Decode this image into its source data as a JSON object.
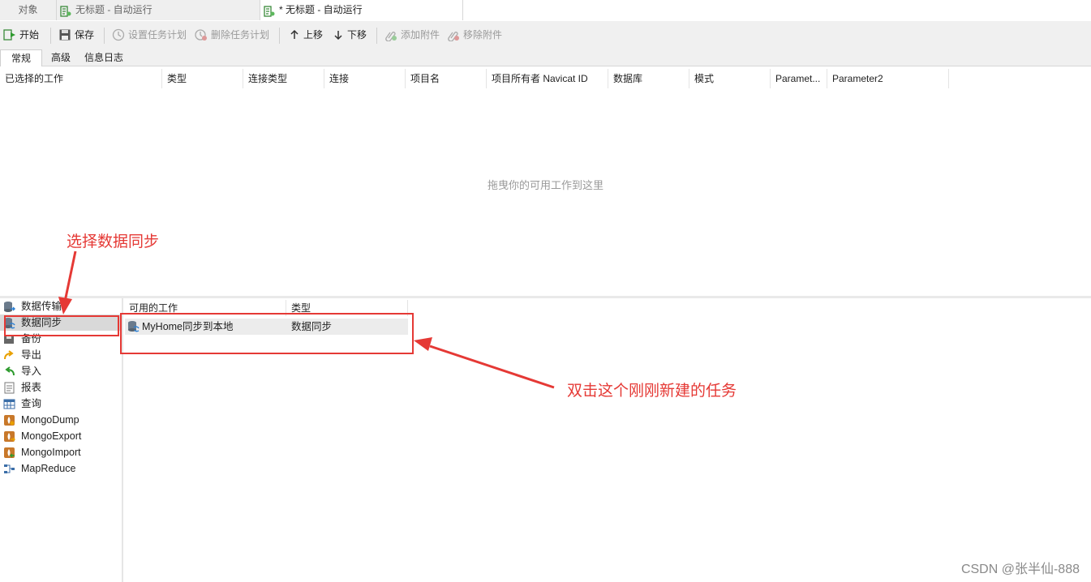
{
  "window_tabs": [
    {
      "label": "对象"
    },
    {
      "label": "无标题 - 自动运行"
    },
    {
      "label": "* 无标题 - 自动运行"
    }
  ],
  "toolbar": {
    "start": "开始",
    "save": "保存",
    "set_schedule": "设置任务计划",
    "delete_schedule": "删除任务计划",
    "move_up": "上移",
    "move_down": "下移",
    "add_attachment": "添加附件",
    "remove_attachment": "移除附件"
  },
  "sub_tabs": [
    "常规",
    "高级",
    "信息日志"
  ],
  "selected_jobs": {
    "columns": [
      "已选择的工作",
      "类型",
      "连接类型",
      "连接",
      "项目名",
      "项目所有者 Navicat ID",
      "数据库",
      "模式",
      "Paramet...",
      "Parameter2"
    ],
    "empty_text": "拖曳你的可用工作到这里"
  },
  "categories": [
    {
      "label": "数据传输",
      "icon": "data-transfer-icon"
    },
    {
      "label": "数据同步",
      "icon": "data-sync-icon"
    },
    {
      "label": "备份",
      "icon": "backup-icon"
    },
    {
      "label": "导出",
      "icon": "export-icon"
    },
    {
      "label": "导入",
      "icon": "import-icon"
    },
    {
      "label": "报表",
      "icon": "report-icon"
    },
    {
      "label": "查询",
      "icon": "query-icon"
    },
    {
      "label": "MongoDump",
      "icon": "mongodump-icon"
    },
    {
      "label": "MongoExport",
      "icon": "mongoexport-icon"
    },
    {
      "label": "MongoImport",
      "icon": "mongoimport-icon"
    },
    {
      "label": "MapReduce",
      "icon": "mapreduce-icon"
    }
  ],
  "available_jobs": {
    "columns": [
      "可用的工作",
      "类型"
    ],
    "rows": [
      {
        "name": "MyHome同步到本地",
        "type": "数据同步"
      }
    ]
  },
  "annotations": {
    "select_sync": "选择数据同步",
    "double_click": "双击这个刚刚新建的任务",
    "color": "#e53935"
  },
  "watermark": "CSDN @张半仙-888"
}
